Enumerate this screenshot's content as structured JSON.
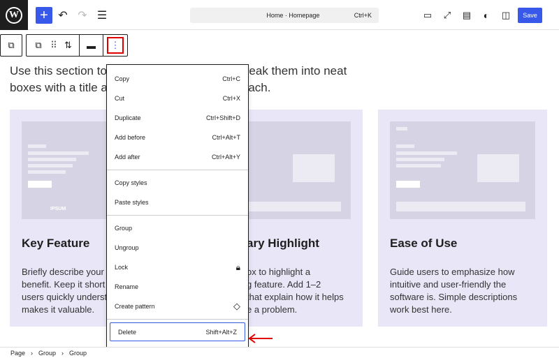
{
  "topbar": {
    "logo": "W",
    "add": "+",
    "undo": "↶",
    "redo": "↷",
    "list": "☰",
    "command": {
      "title": "Home · Homepage",
      "shortcut": "Ctrl+K"
    },
    "save": "Save"
  },
  "toolbar": {
    "parent": "⧉",
    "transform": "⧉",
    "drag": "⠿",
    "move": "⇅",
    "align": "▬",
    "options": "⋮"
  },
  "intro": {
    "line1": "Use this section to",
    "line1b": "ures. Break them into neat",
    "line2": "boxes with a title a",
    "line2b": "each."
  },
  "cards": [
    {
      "title": "Key Feature",
      "desc": "Briefly describe your\nbenefit. Keep it short\nusers quickly underst\nmakes it valuable.",
      "logos": [
        "IPSUM"
      ]
    },
    {
      "title": "ary Highlight",
      "desc": "ox to highlight a\ng feature. Add 1–2\nthat explain how it helps\ne a problem."
    },
    {
      "title": "Ease of Use",
      "desc": "Guide users to emphasize how\nintuitive and user-friendly the\nsoftware is. Simple descriptions\nwork best here."
    }
  ],
  "menu": {
    "group1": [
      {
        "label": "Copy",
        "shortcut": "Ctrl+C"
      },
      {
        "label": "Cut",
        "shortcut": "Ctrl+X"
      },
      {
        "label": "Duplicate",
        "shortcut": "Ctrl+Shift+D"
      },
      {
        "label": "Add before",
        "shortcut": "Ctrl+Alt+T"
      },
      {
        "label": "Add after",
        "shortcut": "Ctrl+Alt+Y"
      }
    ],
    "group2": [
      {
        "label": "Copy styles"
      },
      {
        "label": "Paste styles"
      }
    ],
    "group3": [
      {
        "label": "Group"
      },
      {
        "label": "Ungroup"
      },
      {
        "label": "Lock",
        "icon": "lock-icon"
      },
      {
        "label": "Rename"
      },
      {
        "label": "Create pattern",
        "icon": "pattern-icon"
      }
    ],
    "delete": {
      "label": "Delete",
      "shortcut": "Shift+Alt+Z"
    }
  },
  "breadcrumb": [
    "Page",
    "Group",
    "Group"
  ],
  "colors": {
    "accent": "#3858e9",
    "highlight": "#e00000",
    "arrow": "#e00000"
  }
}
